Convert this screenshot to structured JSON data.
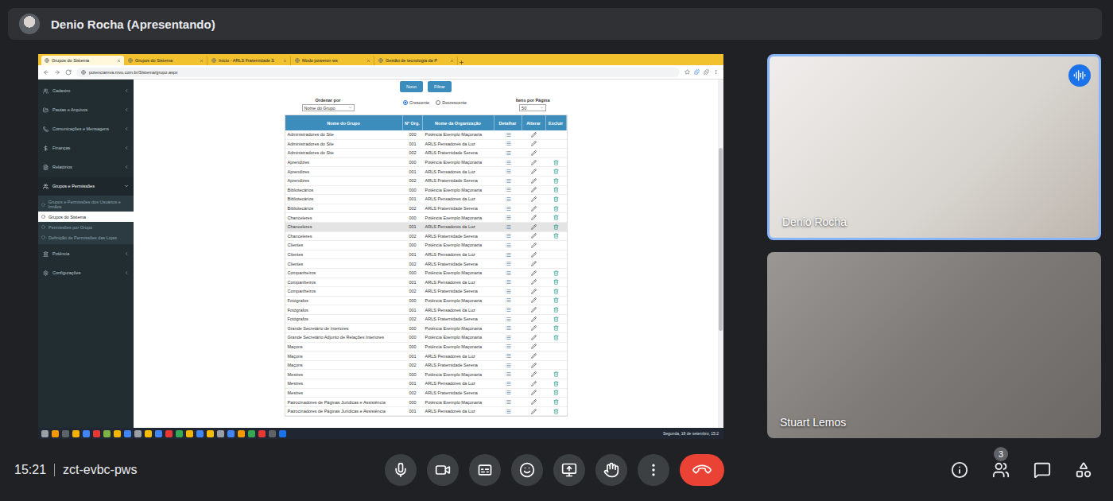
{
  "presenter_banner": {
    "name": "Denio Rocha (Apresentando)"
  },
  "shared_screen": {
    "browser": {
      "tabs": [
        {
          "label": "Grupos do Sistema",
          "selected": true
        },
        {
          "label": "Grupos do Sistema",
          "selected": false
        },
        {
          "label": "Início - ARLS Fraternidade S",
          "selected": false
        },
        {
          "label": "Modo poweron ws",
          "selected": false
        },
        {
          "label": "Gestão de tecnologia da P",
          "selected": false
        }
      ],
      "address": "potenciamva.mvu.com.br/Sistema/grupo.aspx"
    },
    "sidebar": {
      "items": [
        {
          "label": "Cadastro",
          "expanded": false,
          "children": []
        },
        {
          "label": "Pautas e Arquivos",
          "expanded": false,
          "children": []
        },
        {
          "label": "Comunicações e Mensagens",
          "expanded": false,
          "children": []
        },
        {
          "label": "Finanças",
          "expanded": false,
          "children": []
        },
        {
          "label": "Relatórios",
          "expanded": false,
          "children": []
        },
        {
          "label": "Grupos e Permissões",
          "expanded": true,
          "children": [
            {
              "label": "Grupos e Permissões dos Usuários e Irmãos",
              "selected": false
            },
            {
              "label": "Grupos do Sistema",
              "selected": true
            },
            {
              "label": "Permissões por Grupo",
              "selected": false
            },
            {
              "label": "Definição de Permissões das Lojas",
              "selected": false
            }
          ]
        },
        {
          "label": "Potência",
          "expanded": false,
          "children": []
        },
        {
          "label": "Configurações",
          "expanded": false,
          "children": []
        }
      ]
    },
    "actions": [
      "Novo",
      "Filtrar"
    ],
    "sort": {
      "label": "Ordenar por",
      "value": "Nome do Grupo",
      "directions": [
        {
          "label": "Crescente",
          "selected": true
        },
        {
          "label": "Decrescente",
          "selected": false
        }
      ]
    },
    "page_size": {
      "label": "Itens por Página",
      "value": "50"
    },
    "table": {
      "columns": [
        "Nome do Grupo",
        "Nº Org.",
        "Nome da Organização",
        "Detalhar",
        "Alterar",
        "Excluir"
      ],
      "rows": [
        {
          "name": "Administradores do Site",
          "org": "000",
          "organization": "Potência Exemplo Maçonaria",
          "deletable": false,
          "highlighted": false
        },
        {
          "name": "Administradores do Site",
          "org": "001",
          "organization": "ARLS Pensadores da Luz",
          "deletable": false,
          "highlighted": false
        },
        {
          "name": "Administradores do Site",
          "org": "002",
          "organization": "ARLS Fraternidade Serena",
          "deletable": false,
          "highlighted": false
        },
        {
          "name": "Aprendizes",
          "org": "000",
          "organization": "Potência Exemplo Maçonaria",
          "deletable": true,
          "highlighted": false
        },
        {
          "name": "Aprendizes",
          "org": "001",
          "organization": "ARLS Pensadores da Luz",
          "deletable": true,
          "highlighted": false
        },
        {
          "name": "Aprendizes",
          "org": "002",
          "organization": "ARLS Fraternidade Serena",
          "deletable": true,
          "highlighted": false
        },
        {
          "name": "Bibliotecários",
          "org": "000",
          "organization": "Potência Exemplo Maçonaria",
          "deletable": true,
          "highlighted": false
        },
        {
          "name": "Bibliotecários",
          "org": "001",
          "organization": "ARLS Pensadores da Luz",
          "deletable": true,
          "highlighted": false
        },
        {
          "name": "Bibliotecários",
          "org": "002",
          "organization": "ARLS Fraternidade Serena",
          "deletable": true,
          "highlighted": false
        },
        {
          "name": "Chanceleres",
          "org": "000",
          "organization": "Potência Exemplo Maçonaria",
          "deletable": true,
          "highlighted": false
        },
        {
          "name": "Chanceleres",
          "org": "001",
          "organization": "ARLS Pensadores da Luz",
          "deletable": true,
          "highlighted": true
        },
        {
          "name": "Chanceleres",
          "org": "002",
          "organization": "ARLS Fraternidade Serena",
          "deletable": true,
          "highlighted": false
        },
        {
          "name": "Clientes",
          "org": "000",
          "organization": "Potência Exemplo Maçonaria",
          "deletable": false,
          "highlighted": false
        },
        {
          "name": "Clientes",
          "org": "001",
          "organization": "ARLS Pensadores da Luz",
          "deletable": false,
          "highlighted": false
        },
        {
          "name": "Clientes",
          "org": "002",
          "organization": "ARLS Fraternidade Serena",
          "deletable": false,
          "highlighted": false
        },
        {
          "name": "Companheiros",
          "org": "000",
          "organization": "Potência Exemplo Maçonaria",
          "deletable": true,
          "highlighted": false
        },
        {
          "name": "Companheiros",
          "org": "001",
          "organization": "ARLS Pensadores da Luz",
          "deletable": true,
          "highlighted": false
        },
        {
          "name": "Companheiros",
          "org": "002",
          "organization": "ARLS Fraternidade Serena",
          "deletable": true,
          "highlighted": false
        },
        {
          "name": "Fotógrafos",
          "org": "000",
          "organization": "Potência Exemplo Maçonaria",
          "deletable": true,
          "highlighted": false
        },
        {
          "name": "Fotógrafos",
          "org": "001",
          "organization": "ARLS Pensadores da Luz",
          "deletable": true,
          "highlighted": false
        },
        {
          "name": "Fotógrafos",
          "org": "002",
          "organization": "ARLS Fraternidade Serena",
          "deletable": true,
          "highlighted": false
        },
        {
          "name": "Grande Secretário de Interiores",
          "org": "000",
          "organization": "Potência Exemplo Maçonaria",
          "deletable": true,
          "highlighted": false
        },
        {
          "name": "Grande Secretário Adjunto de Relações Interiores",
          "org": "000",
          "organization": "Potência Exemplo Maçonaria",
          "deletable": true,
          "highlighted": false
        },
        {
          "name": "Maçons",
          "org": "000",
          "organization": "Potência Exemplo Maçonaria",
          "deletable": false,
          "highlighted": false
        },
        {
          "name": "Maçons",
          "org": "001",
          "organization": "ARLS Pensadores da Luz",
          "deletable": false,
          "highlighted": false
        },
        {
          "name": "Maçons",
          "org": "002",
          "organization": "ARLS Fraternidade Serena",
          "deletable": false,
          "highlighted": false
        },
        {
          "name": "Mestres",
          "org": "000",
          "organization": "Potência Exemplo Maçonaria",
          "deletable": true,
          "highlighted": false
        },
        {
          "name": "Mestres",
          "org": "001",
          "organization": "ARLS Pensadores da Luz",
          "deletable": true,
          "highlighted": false
        },
        {
          "name": "Mestres",
          "org": "002",
          "organization": "ARLS Fraternidade Serena",
          "deletable": true,
          "highlighted": false
        },
        {
          "name": "Patrocinadores de Páginas Jurídicas e Assistência",
          "org": "000",
          "organization": "Potência Exemplo Maçonaria",
          "deletable": true,
          "highlighted": false
        },
        {
          "name": "Patrocinadores de Páginas Jurídicas e Assistência",
          "org": "001",
          "organization": "ARLS Pensadores da Luz",
          "deletable": true,
          "highlighted": false
        }
      ]
    },
    "taskbar": {
      "clock": "Segunda, 18 de setembro, 15:2"
    }
  },
  "tiles": [
    {
      "name": "Denio Rocha",
      "speaking": true
    },
    {
      "name": "Stuart Lemos",
      "speaking": false
    }
  ],
  "bottom_bar": {
    "time": "15:21",
    "meeting_code": "zct-evbc-pws",
    "controls": [
      {
        "kind": "mic"
      },
      {
        "kind": "camera"
      },
      {
        "kind": "captions"
      },
      {
        "kind": "emoji"
      },
      {
        "kind": "present"
      },
      {
        "kind": "hand"
      },
      {
        "kind": "more"
      },
      {
        "kind": "leave"
      }
    ],
    "tools": [
      {
        "kind": "info",
        "badge": ""
      },
      {
        "kind": "people",
        "badge": "3"
      },
      {
        "kind": "chat",
        "badge": ""
      },
      {
        "kind": "activities",
        "badge": ""
      }
    ]
  }
}
